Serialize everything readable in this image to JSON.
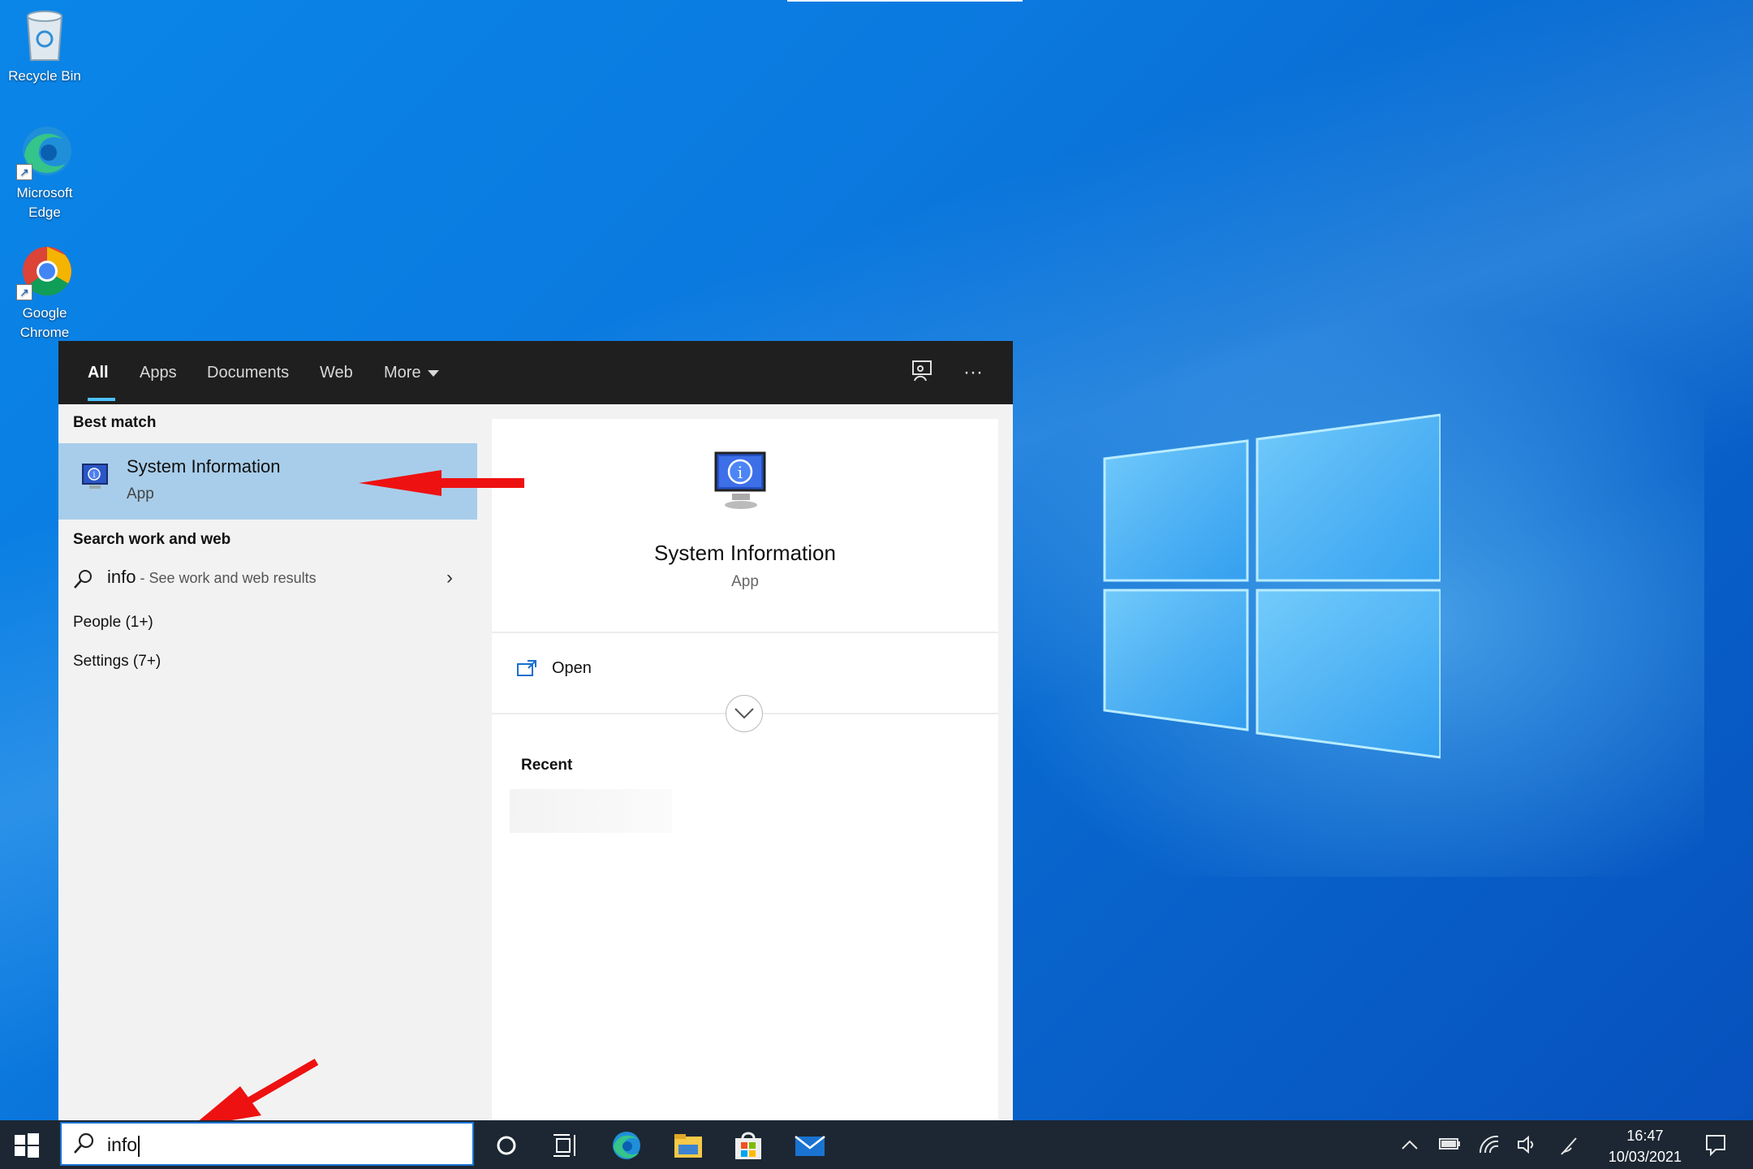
{
  "desktop": {
    "icons": [
      {
        "label": "Recycle Bin"
      },
      {
        "label": "Microsoft Edge"
      },
      {
        "label": "Google Chrome"
      }
    ]
  },
  "search_panel": {
    "tabs": [
      {
        "label": "All",
        "active": true
      },
      {
        "label": "Apps"
      },
      {
        "label": "Documents"
      },
      {
        "label": "Web"
      },
      {
        "label": "More"
      }
    ],
    "best_match": {
      "heading": "Best match",
      "title": "System Information",
      "subtitle": "App"
    },
    "search_work_web": {
      "heading": "Search work and web",
      "query": "info",
      "suffix": " - See work and web results"
    },
    "categories": [
      {
        "label": "People (1+)"
      },
      {
        "label": "Settings (7+)"
      }
    ],
    "preview": {
      "title": "System Information",
      "subtitle": "App",
      "open_label": "Open",
      "recent_heading": "Recent"
    }
  },
  "taskbar": {
    "search_value": "info",
    "clock_time": "16:47",
    "clock_date": "10/03/2021"
  },
  "colors": {
    "accent": "#4cc2ff",
    "selection": "#a8cdea",
    "taskbar": "#1c2733",
    "annotation_arrow": "#ee1111"
  }
}
